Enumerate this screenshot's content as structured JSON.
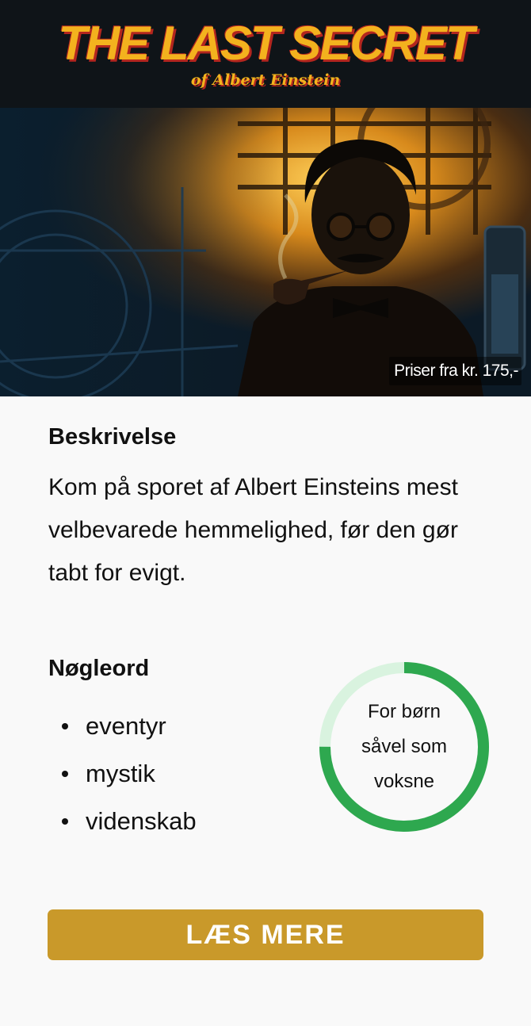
{
  "logo": {
    "title": "THE LAST SECRET",
    "subtitle": "of Albert Einstein"
  },
  "hero": {
    "price_label": "Priser fra kr. 175,-"
  },
  "description": {
    "heading": "Beskrivelse",
    "text": "Kom på sporet af Albert Einsteins mest velbevarede hemmelighed, før den gør tabt for evigt."
  },
  "keywords": {
    "heading": "Nøgleord",
    "items": [
      "eventyr",
      "mystik",
      "videnskab"
    ]
  },
  "audience": {
    "label": "For børn såvel som voksne",
    "ring_fill_fraction": 0.75
  },
  "cta": {
    "label": "LÆS MERE"
  },
  "colors": {
    "accent": "#c9992a",
    "ring_green": "#2ea84f",
    "ring_track": "#d9f3df",
    "logo_gold": "#f3b21e",
    "logo_red": "#b3261e",
    "header_bg": "#0f1418"
  }
}
